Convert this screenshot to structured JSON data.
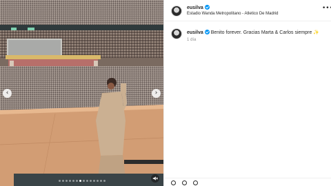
{
  "post": {
    "username": "eusilva",
    "location": "Estadio Wanda Metropolitano - Atletico De Madrid",
    "more_icon": "more-horizontal-icon"
  },
  "caption": {
    "username": "eusilva",
    "text": "Benito forever. Gracias Marta & Carlos siempre",
    "emoji": "✨",
    "time": "1 día"
  },
  "carousel": {
    "prev_icon": "‹",
    "next_icon": "›",
    "total_slides": 14,
    "active_slide": 6
  },
  "colors": {
    "verified": "#0095f6",
    "text": "#262626",
    "muted": "#8e8e8e",
    "divider": "#efefef"
  }
}
